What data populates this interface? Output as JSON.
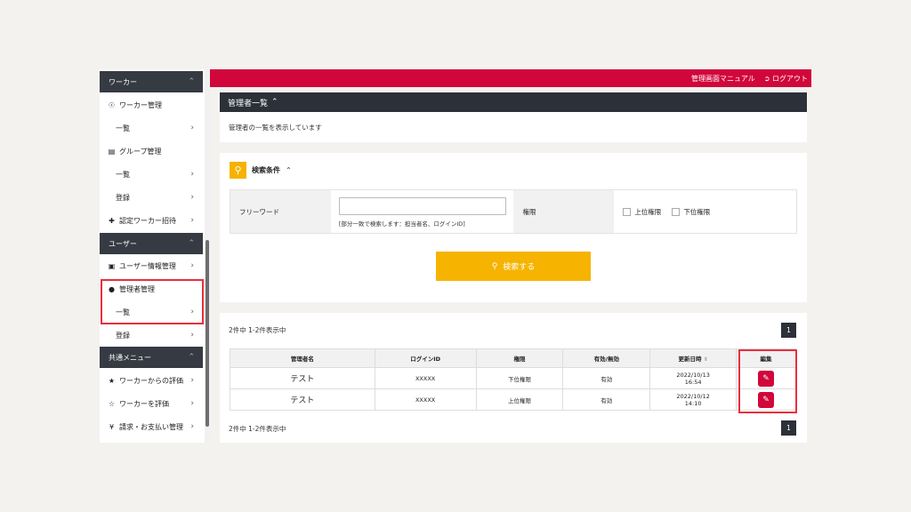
{
  "sidebar": {
    "sections": [
      {
        "label": "ワーカー",
        "chevron": "^"
      },
      {
        "label": "ユーザー",
        "chevron": "^"
      },
      {
        "label": "共通メニュー",
        "chevron": "^"
      }
    ],
    "items": [
      {
        "label": "ワーカー管理",
        "icon": "person-outline-icon"
      },
      {
        "label": "一覧"
      },
      {
        "label": "グループ管理",
        "icon": "group-icon"
      },
      {
        "label": "一覧"
      },
      {
        "label": "登録"
      },
      {
        "label": "認定ワーカー招待",
        "icon": "user-plus-icon"
      },
      {
        "label": "ユーザー情報管理",
        "icon": "id-card-icon"
      },
      {
        "label": "管理者管理",
        "icon": "person-icon"
      },
      {
        "label": "一覧"
      },
      {
        "label": "登録"
      },
      {
        "label": "ワーカーからの評価",
        "icon": "star-filled-icon"
      },
      {
        "label": "ワーカーを評価",
        "icon": "star-outline-icon"
      },
      {
        "label": "請求・お支払い管理",
        "icon": "yen-icon"
      }
    ],
    "chevron": ">"
  },
  "topbar": {
    "manual_label": "管理画面マニュアル",
    "logout_label": "ログアウト",
    "color": "#d1063a"
  },
  "page": {
    "title": "管理者一覧",
    "title_chevron": "^",
    "description": "管理者の一覧を表示しています"
  },
  "search": {
    "title": "検索条件",
    "title_chevron": "^",
    "freeword_label": "フリーワード",
    "freeword_value": "",
    "freeword_hint": "[部分一致で検索します：担当者名、ログインID]",
    "authority_label": "権限",
    "authority_options": [
      {
        "label": "上位権限",
        "checked": false
      },
      {
        "label": "下位権限",
        "checked": false
      }
    ],
    "button_label": "検索する",
    "accent": "#f6b400"
  },
  "results": {
    "count_text": "2件中 1-2件表示中",
    "page": "1",
    "columns": [
      "管理者名",
      "ログインID",
      "権限",
      "有効/無効",
      "更新日時",
      "編集"
    ],
    "sort_icon": "sort-icon",
    "rows": [
      {
        "name": "テスト",
        "login_id": "XXXXX",
        "authority": "下位権限",
        "status": "有効",
        "updated_date": "2022/10/13",
        "updated_time": "16:54"
      },
      {
        "name": "テスト",
        "login_id": "XXXXX",
        "authority": "上位権限",
        "status": "有効",
        "updated_date": "2022/10/12",
        "updated_time": "14:10"
      }
    ]
  }
}
